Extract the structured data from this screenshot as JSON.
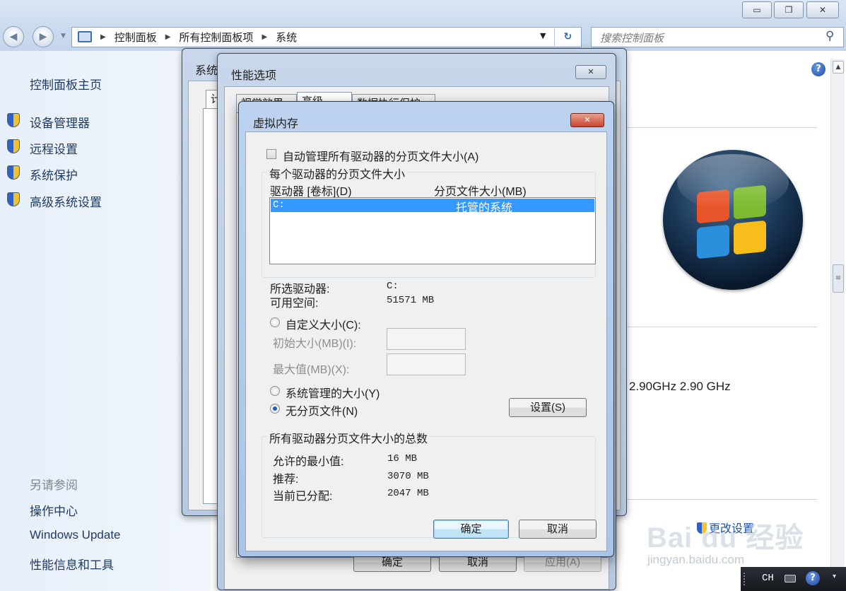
{
  "window": {
    "minimize_icon": "minimize-icon",
    "maximize_icon": "restore-icon",
    "close_icon": "close-icon"
  },
  "address": {
    "crumbs": [
      "控制面板",
      "所有控制面板项",
      "系统"
    ],
    "search_placeholder": "搜索控制面板"
  },
  "sidebar": {
    "home": "控制面板主页",
    "items": [
      {
        "label": "设备管理器",
        "icon": "uac-shield-icon"
      },
      {
        "label": "远程设置",
        "icon": "uac-shield-icon"
      },
      {
        "label": "系统保护",
        "icon": "uac-shield-icon"
      },
      {
        "label": "高级系统设置",
        "icon": "uac-shield-icon"
      }
    ],
    "see_also_title": "另请参阅",
    "see_also": [
      "操作中心",
      "Windows Update",
      "性能信息和工具"
    ]
  },
  "main": {
    "cpu_speed": "2.90GHz   2.90 GHz",
    "change_settings": "更改设置"
  },
  "system_dialog": {
    "title_fragment": "系统",
    "tab_fragment": "计"
  },
  "performance_dialog": {
    "title": "性能选项",
    "tabs": [
      "视觉效果",
      "高级",
      "数据执行保护"
    ],
    "ok": "确定",
    "cancel": "取消",
    "apply": "应用(A)"
  },
  "virtual_memory_dialog": {
    "title": "虚拟内存",
    "auto_manage_label": "自动管理所有驱动器的分页文件大小(A)",
    "auto_manage_checked": false,
    "per_drive_group": "每个驱动器的分页文件大小",
    "col_drive": "驱动器 [卷标](D)",
    "col_size": "分页文件大小(MB)",
    "drives": [
      {
        "drive": "C:",
        "size": "托管的系统"
      }
    ],
    "selected_drive_label": "所选驱动器:",
    "selected_drive_value": "C:",
    "free_space_label": "可用空间:",
    "free_space_value": "51571 MB",
    "custom_size_label": "自定义大小(C):",
    "initial_size_label": "初始大小(MB)(I):",
    "max_size_label": "最大值(MB)(X):",
    "system_managed_label": "系统管理的大小(Y)",
    "no_paging_label": "无分页文件(N)",
    "selected_option": "无分页文件(N)",
    "set_button": "设置(S)",
    "totals_group": "所有驱动器分页文件大小的总数",
    "min_allowed_label": "允许的最小值:",
    "min_allowed_value": "16 MB",
    "recommended_label": "推荐:",
    "recommended_value": "3070 MB",
    "allocated_label": "当前已分配:",
    "allocated_value": "2047 MB",
    "ok": "确定",
    "cancel": "取消"
  },
  "watermark": {
    "logo": "Bai du 经验",
    "url": "jingyan.baidu.com"
  },
  "taskbar": {
    "language": "CH"
  }
}
